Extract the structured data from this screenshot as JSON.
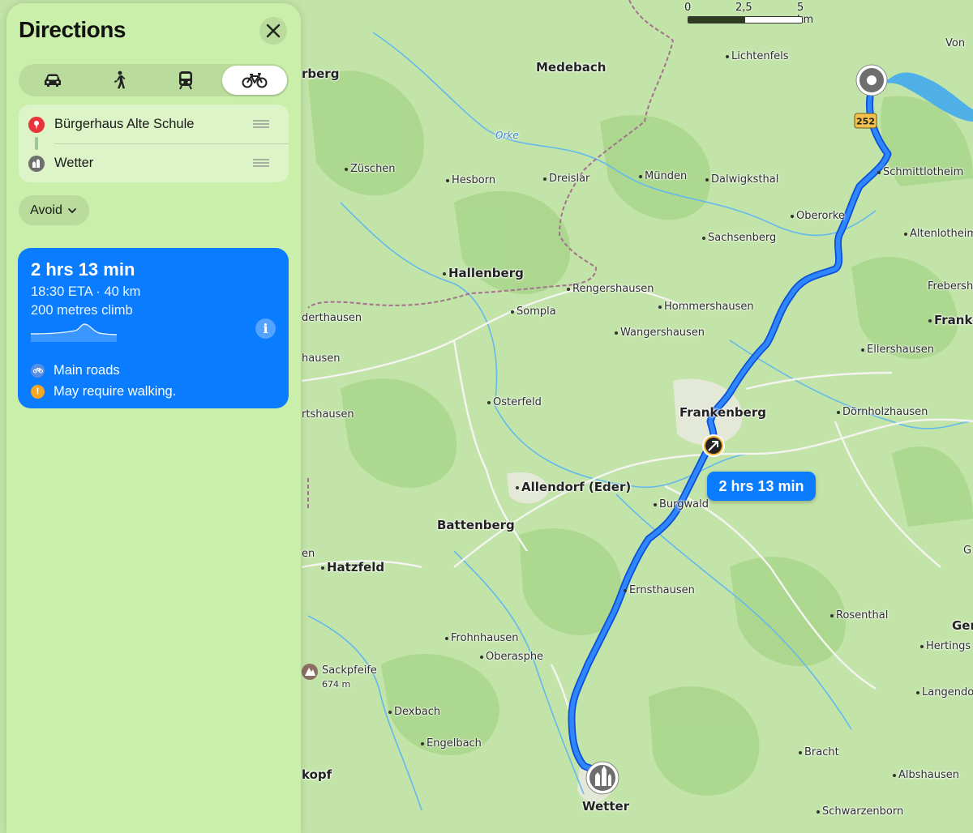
{
  "panel": {
    "title": "Directions",
    "close_icon": "close-icon",
    "modes": [
      {
        "icon": "car-icon",
        "active": false
      },
      {
        "icon": "walk-icon",
        "active": false
      },
      {
        "icon": "transit-icon",
        "active": false
      },
      {
        "icon": "bicycle-icon",
        "active": true
      }
    ],
    "stops": [
      {
        "name": "Bürgerhaus Alte Schule",
        "icon": "red-pin-icon"
      },
      {
        "name": "Wetter",
        "icon": "landmark-icon"
      }
    ],
    "avoid_label": "Avoid",
    "route": {
      "time": "2 hrs 13 min",
      "eta_distance": "18:30 ETA · 40 km",
      "climb": "200 metres climb",
      "info_glyph": "i",
      "notes": [
        {
          "text": "Main roads",
          "icon": "bicycle-badge-icon"
        },
        {
          "text": "May require walking.",
          "icon": "warning-icon"
        }
      ]
    }
  },
  "map": {
    "scale": {
      "labels": [
        "0",
        "2,5",
        "5 km"
      ]
    },
    "callout": "2 hrs 13 min",
    "road_shield": "252",
    "peak": {
      "name": "Sackpfeife",
      "elevation": "674 m"
    },
    "towns_major": [
      "Frankenberg",
      "Battenberg",
      "Medebach",
      "Hallenberg",
      "Hatzfeld",
      "Allendorf (Eder)",
      "Wetter"
    ],
    "towns_minor": [
      "Lichtenfels",
      "Züschen",
      "Hesborn",
      "Dreislar",
      "Münden",
      "Dalwigksthal",
      "Schmittlotheim",
      "Oberorke",
      "Sachsenberg",
      "Altenlotheim",
      "Rengershausen",
      "Sompla",
      "Hommershausen",
      "Wangershausen",
      "Ellershausen",
      "Osterfeld",
      "Dörnholzhausen",
      "Burgwald",
      "Ernsthausen",
      "Rosenthal",
      "Frohnhausen",
      "Oberasphe",
      "Hertings",
      "Langendo",
      "Dexbach",
      "Engelbach",
      "Bracht",
      "Albshausen",
      "Schwarzenborn"
    ],
    "edge_labels": [
      "Von",
      "Frebersh",
      "Franke",
      "Ger",
      "G",
      "rberg",
      "derthausen",
      "hausen",
      "rtshausen",
      "en",
      "kopf"
    ],
    "river": "Orke",
    "colors": {
      "route": "#1a6fff",
      "water": "#4fb0e8",
      "land": "#bfe2a6",
      "forest": "#a6d488"
    }
  }
}
